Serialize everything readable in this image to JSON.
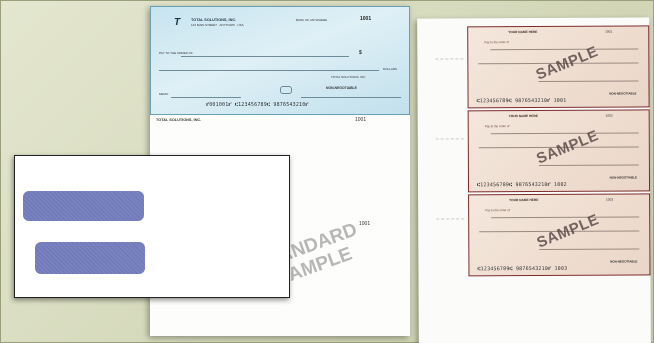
{
  "colors": {
    "background": "#d9dcc2",
    "check_blue": "#c7e4ef",
    "check_border_blue": "#6aa0b6",
    "check_tan": "#ead6c7",
    "check_border_maroon": "#7c2a2a",
    "envelope_window": "#aeb5dc"
  },
  "standard_check": {
    "logo": "T",
    "company": "TOTAL SOLUTIONS, INC.",
    "address": "123 MAIN STREET · ANYTOWN · USA",
    "bank": "BANK OF ANYWHERE",
    "check_number": "1001",
    "pay_to": "PAY TO THE ORDER OF",
    "dollar_sign": "$",
    "dollars_label": "DOLLARS",
    "company_short": "TOTAL SOLUTIONS, INC.",
    "non_negotiable": "NON-NEGOTIABLE",
    "memo": "MEMO",
    "micr": "⑈001001⑈ ⑆123456789⑆ 9876543210⑈",
    "stub_company": "TOTAL SOLUTIONS, INC.",
    "stub_number_1": "1001",
    "stub_number_2": "1001",
    "stamp_line1": "STANDARD",
    "stamp_line2": "SAMPLE"
  },
  "three_per_page": {
    "checks": [
      {
        "owner": "YOUR NAME HERE",
        "number": "1001",
        "pay": "Pay to the order of",
        "non_negotiable": "NON-NEGOTIABLE",
        "micr": "⑆123456789⑆ 9876543210⑈ 1001",
        "stamp": "SAMPLE"
      },
      {
        "owner": "YOUR NAME HERE",
        "number": "1002",
        "pay": "Pay to the order of",
        "non_negotiable": "NON-NEGOTIABLE",
        "micr": "⑆123456789⑆ 9876543210⑈ 1002",
        "stamp": "SAMPLE"
      },
      {
        "owner": "YOUR NAME HERE",
        "number": "1003",
        "pay": "Pay to the order of",
        "non_negotiable": "NON-NEGOTIABLE",
        "micr": "⑆123456789⑆ 9876543210⑈ 1003",
        "stamp": "SAMPLE"
      }
    ]
  }
}
